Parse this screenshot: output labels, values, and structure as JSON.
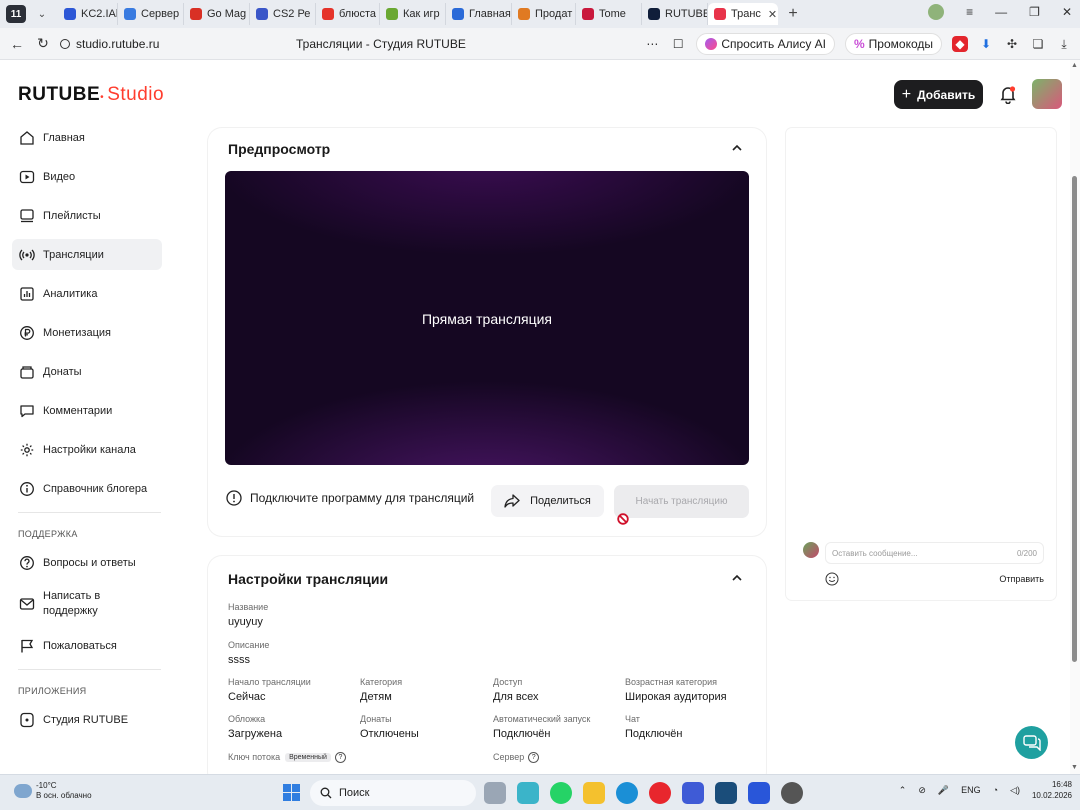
{
  "browser": {
    "tab_count": "11",
    "tabs": [
      {
        "label": "KC2.IAll",
        "color": "#2d57d6"
      },
      {
        "label": "Сервер",
        "color": "#3a7be0"
      },
      {
        "label": "Go Mag",
        "color": "#d93025"
      },
      {
        "label": "CS2 Ре",
        "color": "#3a56c8"
      },
      {
        "label": "блюста",
        "color": "#e5332a"
      },
      {
        "label": "Как игр",
        "color": "#6aa832"
      },
      {
        "label": "Главная",
        "color": "#2a6ad8"
      },
      {
        "label": "Продат",
        "color": "#e07a22"
      },
      {
        "label": "Tome",
        "color": "#c9183c"
      },
      {
        "label": "RUTUBE",
        "color": "#101e3a"
      },
      {
        "label": "Транс",
        "color": "#e8334a",
        "active": true
      }
    ],
    "url": "studio.rutube.ru",
    "page_title": "Трансляции - Студия RUTUBE",
    "alice_label": "Спросить Алису AI",
    "promo_label": "Промокоды"
  },
  "header": {
    "logo_main": "RUTUBE",
    "logo_sub": "Studio",
    "add_button": "Добавить"
  },
  "sidebar": {
    "items": [
      {
        "label": "Главная",
        "icon": "home-icon"
      },
      {
        "label": "Видео",
        "icon": "video-icon"
      },
      {
        "label": "Плейлисты",
        "icon": "playlist-icon"
      },
      {
        "label": "Трансляции",
        "icon": "broadcast-icon",
        "active": true
      },
      {
        "label": "Аналитика",
        "icon": "analytics-icon"
      },
      {
        "label": "Монетизация",
        "icon": "ruble-icon"
      },
      {
        "label": "Донаты",
        "icon": "donate-icon"
      },
      {
        "label": "Комментарии",
        "icon": "comment-icon"
      },
      {
        "label": "Настройки канала",
        "icon": "gear-icon"
      },
      {
        "label": "Справочник блогера",
        "icon": "info-icon"
      }
    ],
    "support_title": "ПОДДЕРЖКА",
    "support_items": [
      {
        "label": "Вопросы и ответы",
        "icon": "question-icon"
      },
      {
        "label": "Написать в поддержку",
        "icon": "mail-icon"
      },
      {
        "label": "Пожаловаться",
        "icon": "flag-icon"
      }
    ],
    "apps_title": "ПРИЛОЖЕНИЯ",
    "apps_items": [
      {
        "label": "Студия RUTUBE",
        "icon": "studio-icon"
      }
    ]
  },
  "preview": {
    "title": "Предпросмотр",
    "video_text": "Прямая трансляция",
    "connect_text": "Подключите программу для трансляций",
    "share_label": "Поделиться",
    "start_label": "Начать трансляцию"
  },
  "settings": {
    "title": "Настройки трансляции",
    "name_label": "Название",
    "name_value": "uyuyuy",
    "desc_label": "Описание",
    "desc_value": "ssss",
    "fields": [
      {
        "label": "Начало трансляции",
        "value": "Сейчас"
      },
      {
        "label": "Категория",
        "value": "Детям"
      },
      {
        "label": "Доступ",
        "value": "Для всех"
      },
      {
        "label": "Возрастная категория",
        "value": "Широкая аудитория"
      },
      {
        "label": "Обложка",
        "value": "Загружена"
      },
      {
        "label": "Донаты",
        "value": "Отключены"
      },
      {
        "label": "Автоматический запуск",
        "value": "Подключён"
      },
      {
        "label": "Чат",
        "value": "Подключён"
      }
    ],
    "stream_key_label": "Ключ потока",
    "stream_key_badge": "Временный",
    "server_label": "Сервер"
  },
  "chat": {
    "placeholder": "Оставить сообщение...",
    "counter": "0/200",
    "send_label": "Отправить"
  },
  "taskbar": {
    "temp": "-10°C",
    "weather": "В осн. облачно",
    "search": "Поиск",
    "lang": "ENG",
    "time": "16:48",
    "date": "10.02.2026"
  }
}
